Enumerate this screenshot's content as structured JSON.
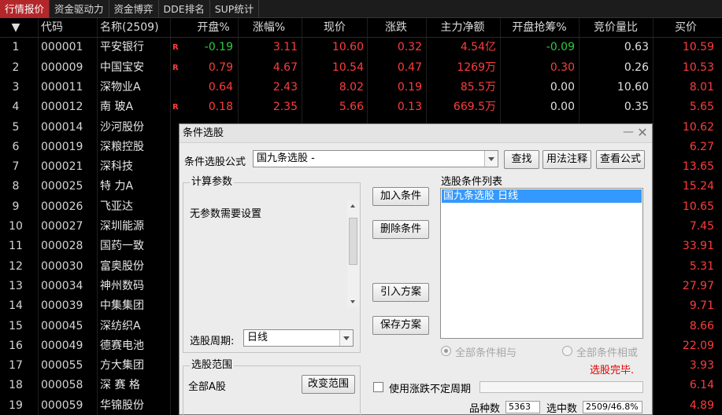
{
  "tabs": [
    {
      "label": "行情报价",
      "active": true
    },
    {
      "label": "资金驱动力",
      "active": false
    },
    {
      "label": "资金博弈",
      "active": false
    },
    {
      "label": "DDE排名",
      "active": false
    },
    {
      "label": "SUP统计",
      "active": false
    }
  ],
  "table": {
    "sort_indicator": "▼",
    "headers": {
      "code": "代码",
      "name": "名称(2509)",
      "open_pct": "开盘%",
      "chg_pct": "涨幅%",
      "price": "现价",
      "diff": "涨跌",
      "net": "主力净额",
      "grab": "开盘抢筹%",
      "bid_ratio": "竞价量比",
      "buy": "买价"
    },
    "rows": [
      {
        "idx": "1",
        "code": "000001",
        "name": "平安银行",
        "r": "R",
        "open": "-0.19",
        "chg": "3.11",
        "price": "10.60",
        "diff": "0.32",
        "net": "4.54亿",
        "grab": "-0.09",
        "bid": "0.63",
        "buy": "10.59"
      },
      {
        "idx": "2",
        "code": "000009",
        "name": "中国宝安",
        "r": "R",
        "open": "0.79",
        "chg": "4.67",
        "price": "10.54",
        "diff": "0.47",
        "net": "1269万",
        "grab": "0.30",
        "bid": "0.26",
        "buy": "10.53"
      },
      {
        "idx": "3",
        "code": "000011",
        "name": "深物业A",
        "r": "",
        "open": "0.64",
        "chg": "2.43",
        "price": "8.02",
        "diff": "0.19",
        "net": "85.5万",
        "grab": "0.00",
        "bid": "10.60",
        "buy": "8.01"
      },
      {
        "idx": "4",
        "code": "000012",
        "name": "南 玻A",
        "r": "R",
        "open": "0.18",
        "chg": "2.35",
        "price": "5.66",
        "diff": "0.13",
        "net": "669.5万",
        "grab": "0.00",
        "bid": "0.35",
        "buy": "5.65"
      },
      {
        "idx": "5",
        "code": "000014",
        "name": "沙河股份",
        "r": "",
        "open": "",
        "chg": "",
        "price": "",
        "diff": "",
        "net": "",
        "grab": "",
        "bid": "",
        "buy": "10.62"
      },
      {
        "idx": "6",
        "code": "000019",
        "name": "深粮控股",
        "r": "",
        "open": "",
        "chg": "",
        "price": "",
        "diff": "",
        "net": "",
        "grab": "",
        "bid": "",
        "buy": "6.27"
      },
      {
        "idx": "7",
        "code": "000021",
        "name": "深科技",
        "r": "",
        "open": "",
        "chg": "",
        "price": "",
        "diff": "",
        "net": "",
        "grab": "",
        "bid": "",
        "buy": "13.65"
      },
      {
        "idx": "8",
        "code": "000025",
        "name": "特 力A",
        "r": "",
        "open": "",
        "chg": "",
        "price": "",
        "diff": "",
        "net": "",
        "grab": "",
        "bid": "",
        "buy": "15.24"
      },
      {
        "idx": "9",
        "code": "000026",
        "name": "飞亚达",
        "r": "",
        "open": "",
        "chg": "",
        "price": "",
        "diff": "",
        "net": "",
        "grab": "",
        "bid": "",
        "buy": "10.65"
      },
      {
        "idx": "10",
        "code": "000027",
        "name": "深圳能源",
        "r": "",
        "open": "",
        "chg": "",
        "price": "",
        "diff": "",
        "net": "",
        "grab": "",
        "bid": "",
        "buy": "7.45"
      },
      {
        "idx": "11",
        "code": "000028",
        "name": "国药一致",
        "r": "",
        "open": "",
        "chg": "",
        "price": "",
        "diff": "",
        "net": "",
        "grab": "",
        "bid": "",
        "buy": "33.91"
      },
      {
        "idx": "12",
        "code": "000030",
        "name": "富奥股份",
        "r": "",
        "open": "",
        "chg": "",
        "price": "",
        "diff": "",
        "net": "",
        "grab": "",
        "bid": "",
        "buy": "5.31"
      },
      {
        "idx": "13",
        "code": "000034",
        "name": "神州数码",
        "r": "",
        "open": "",
        "chg": "",
        "price": "",
        "diff": "",
        "net": "",
        "grab": "",
        "bid": "",
        "buy": "27.97"
      },
      {
        "idx": "14",
        "code": "000039",
        "name": "中集集团",
        "r": "",
        "open": "",
        "chg": "",
        "price": "",
        "diff": "",
        "net": "",
        "grab": "",
        "bid": "",
        "buy": "9.71"
      },
      {
        "idx": "15",
        "code": "000045",
        "name": "深纺织A",
        "r": "",
        "open": "",
        "chg": "",
        "price": "",
        "diff": "",
        "net": "",
        "grab": "",
        "bid": "",
        "buy": "8.66"
      },
      {
        "idx": "16",
        "code": "000049",
        "name": "德赛电池",
        "r": "",
        "open": "",
        "chg": "",
        "price": "",
        "diff": "",
        "net": "",
        "grab": "",
        "bid": "",
        "buy": "22.09"
      },
      {
        "idx": "17",
        "code": "000055",
        "name": "方大集团",
        "r": "",
        "open": "",
        "chg": "",
        "price": "",
        "diff": "",
        "net": "",
        "grab": "",
        "bid": "",
        "buy": "3.93"
      },
      {
        "idx": "18",
        "code": "000058",
        "name": "深 赛 格",
        "r": "",
        "open": "",
        "chg": "",
        "price": "",
        "diff": "",
        "net": "",
        "grab": "",
        "bid": "",
        "buy": "6.14"
      },
      {
        "idx": "19",
        "code": "000059",
        "name": "华锦股份",
        "r": "",
        "open": "",
        "chg": "",
        "price": "",
        "diff": "",
        "net": "",
        "grab": "",
        "bid": "",
        "buy": "4.89"
      }
    ]
  },
  "dialog": {
    "title": "条件选股",
    "minimize": "—",
    "close": "✕",
    "formula_label": "条件选股公式",
    "formula_value": "国九条选股   -",
    "btn_find": "查找",
    "btn_usage": "用法注释",
    "btn_view": "查看公式",
    "params_title": "计算参数",
    "params_text": "无参数需要设置",
    "period_label": "选股周期:",
    "period_value": "日线",
    "btn_add": "加入条件",
    "btn_delete": "删除条件",
    "btn_import": "引入方案",
    "btn_save": "保存方案",
    "list_label": "选股条件列表",
    "list_items": [
      "国九条选股   日线"
    ],
    "radio_and": "全部条件相与",
    "radio_or": "全部条件相或",
    "done_text": "选股完毕.",
    "range_title": "选股范围",
    "range_value": "全部A股",
    "btn_range": "改变范围",
    "check_label": "使用涨跌不定周期",
    "count_label": "品种数",
    "count_value": "5363",
    "selected_label": "选中数",
    "selected_value": "2509/46.8%"
  },
  "colors": {
    "up": "#ff3c3c",
    "down": "#2ecc40",
    "active_tab": "#b3262a",
    "selection": "#3399ff",
    "done": "#e00000"
  }
}
